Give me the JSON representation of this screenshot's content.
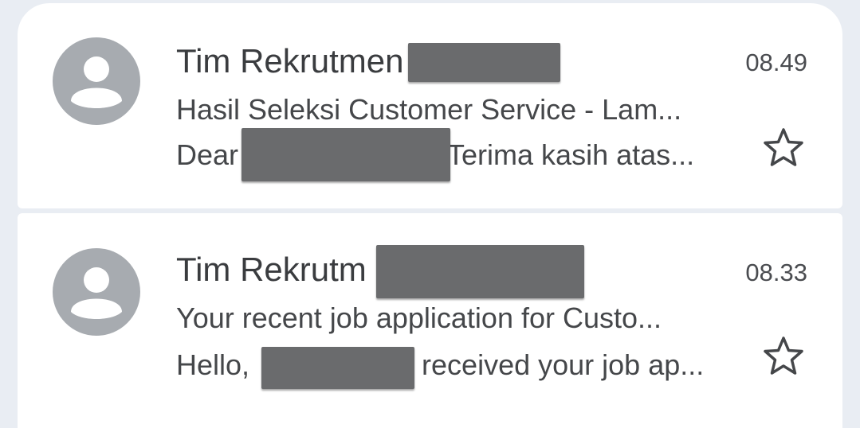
{
  "emails": [
    {
      "sender": "Tim Rekrutmen",
      "subject": "Hasil Seleksi Customer Service - Lam...",
      "snippet_before": "Dear",
      "snippet_after": "Terima kasih atas...",
      "time": "08.49",
      "starred": false
    },
    {
      "sender": "Tim Rekrutm",
      "subject": "Your recent job application for Custo...",
      "snippet_before": "Hello,",
      "snippet_after": "received your job ap...",
      "time": "08.33",
      "starred": false
    }
  ],
  "icons": {
    "avatar": "person-avatar-icon",
    "star": "star-outline-icon"
  },
  "colors": {
    "background": "#e9edf3",
    "card": "#ffffff",
    "avatar": "#a7abb0",
    "redaction": "#6a6b6d"
  }
}
